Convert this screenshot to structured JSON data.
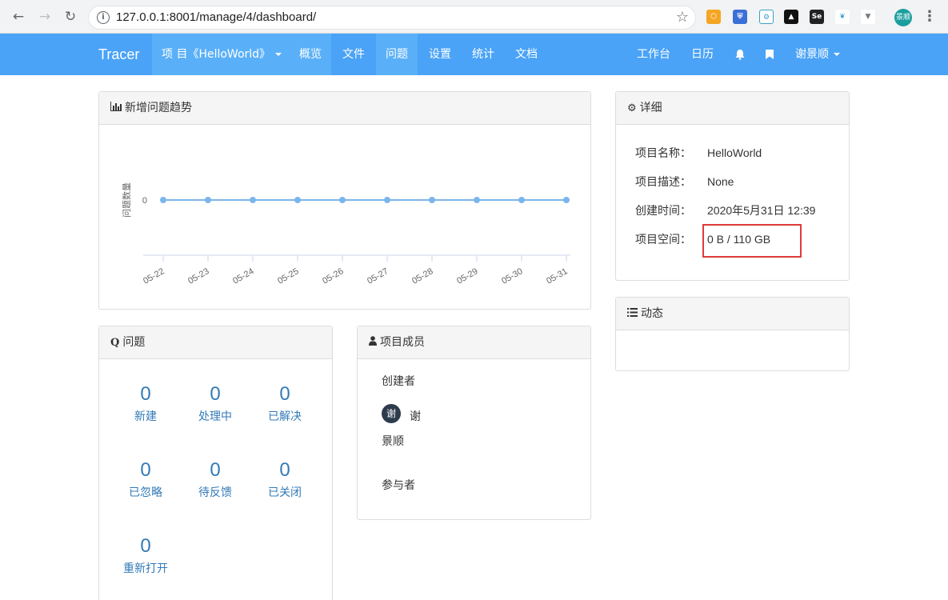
{
  "browser": {
    "url": "127.0.0.1:8001/manage/4/dashboard/",
    "profile_label": "景顺"
  },
  "navbar": {
    "brand": "Tracer",
    "project_menu": "项 目《HelloWorld》",
    "items": [
      "概览",
      "文件",
      "问题",
      "设置",
      "统计",
      "文档"
    ],
    "right": {
      "workbench": "工作台",
      "calendar": "日历",
      "user": "谢景顺"
    }
  },
  "trend_panel": {
    "title": "新增问题趋势"
  },
  "chart_data": {
    "type": "line",
    "title": "",
    "ylabel": "问题数量",
    "xlabel": "",
    "x": [
      "05-22",
      "05-23",
      "05-24",
      "05-25",
      "05-26",
      "05-27",
      "05-28",
      "05-29",
      "05-30",
      "05-31"
    ],
    "series": [
      {
        "values": [
          0,
          0,
          0,
          0,
          0,
          0,
          0,
          0,
          0,
          0
        ]
      }
    ],
    "yticks": [
      "0"
    ],
    "color": "#7cb5ec",
    "grid": false
  },
  "issues_panel": {
    "title": "问题",
    "stats": [
      {
        "value": "0",
        "label": "新建"
      },
      {
        "value": "0",
        "label": "处理中"
      },
      {
        "value": "0",
        "label": "已解决"
      },
      {
        "value": "0",
        "label": "已忽略"
      },
      {
        "value": "0",
        "label": "待反馈"
      },
      {
        "value": "0",
        "label": "已关闭"
      },
      {
        "value": "0",
        "label": "重新打开"
      }
    ]
  },
  "members_panel": {
    "title": "项目成员",
    "creator_label": "创建者",
    "creator_avatar": "谢",
    "creator_name_line1": "谢",
    "creator_name_line2": "景顺",
    "participants_label": "参与者"
  },
  "details_panel": {
    "title": "详细",
    "rows": [
      {
        "key": "项目名称：",
        "value": "HelloWorld"
      },
      {
        "key": "项目描述：",
        "value": "None"
      },
      {
        "key": "创建时间：",
        "value": "2020年5月31日 12:39"
      },
      {
        "key": "项目空间：",
        "value": "0 B / 110 GB"
      }
    ]
  },
  "activity_panel": {
    "title": "动态"
  }
}
